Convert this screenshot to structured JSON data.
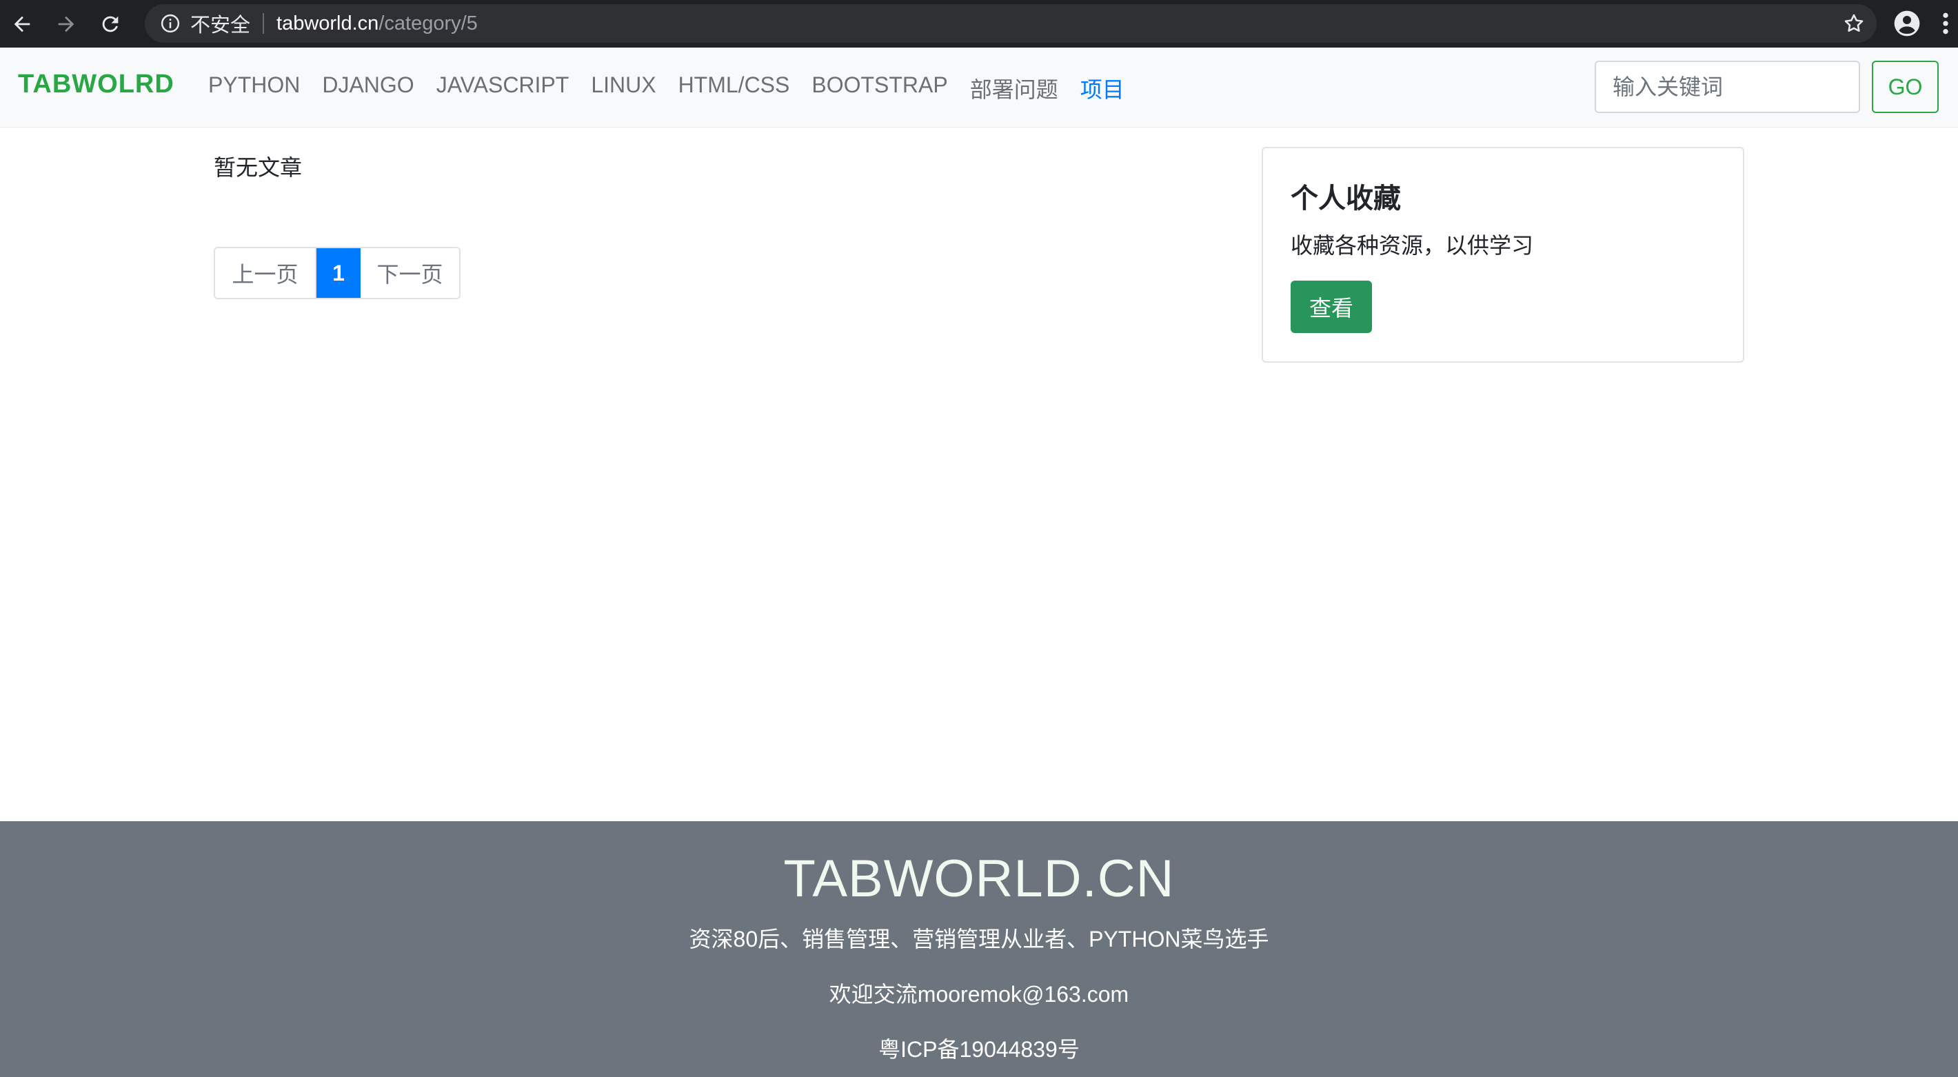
{
  "browser": {
    "security_label": "不安全",
    "url_host": "tabworld.cn",
    "url_path": "/category/5",
    "icons": [
      "back-arrow-icon",
      "forward-arrow-icon",
      "reload-icon",
      "info-icon",
      "star-icon",
      "account-icon",
      "more-menu-icon"
    ]
  },
  "navbar": {
    "brand": "TABWOLRD",
    "links": [
      "PYTHON",
      "DJANGO",
      "JAVASCRIPT",
      "LINUX",
      "HTML/CSS",
      "BOOTSTRAP",
      "部署问题",
      "项目"
    ],
    "active_index": 7,
    "search_placeholder": "输入关键词",
    "go_label": "GO"
  },
  "main": {
    "empty_message": "暂无文章",
    "pagination": {
      "prev": "上一页",
      "current": "1",
      "next": "下一页"
    }
  },
  "sidebar_card": {
    "title": "个人收藏",
    "text": "收藏各种资源，以供学习",
    "button": "查看"
  },
  "footer": {
    "title": "TABWORLD.CN",
    "line1": "资深80后、销售管理、营销管理从业者、PYTHON菜鸟选手",
    "line2": "欢迎交流mooremok@163.com",
    "line3": "粤ICP备19044839号"
  },
  "colors": {
    "brand_green": "#28a745",
    "active_link": "#007bff",
    "footer_bg": "#6c757d",
    "card_button": "#28965a"
  }
}
